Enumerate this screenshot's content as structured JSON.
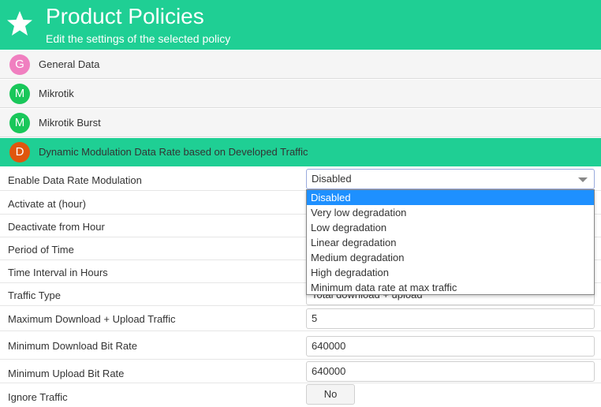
{
  "header": {
    "title": "Product Policies",
    "subtitle": "Edit the settings of the selected policy",
    "icon": "star-icon",
    "bg_color": "#1fcf94"
  },
  "sections": [
    {
      "letter": "G",
      "label": "General Data",
      "color": "#f07fc0"
    },
    {
      "letter": "M",
      "label": "Mikrotik",
      "color": "#19c75a"
    },
    {
      "letter": "M",
      "label": "Mikrotik Burst",
      "color": "#19c75a"
    },
    {
      "letter": "D",
      "label": "Dynamic Modulation Data Rate based on Developed Traffic",
      "color": "#e0560e"
    }
  ],
  "form": {
    "enable_label": "Enable Data Rate Modulation",
    "enable_value": "Disabled",
    "activate_label": "Activate at (hour)",
    "deactivate_label": "Deactivate from Hour",
    "period_label": "Period of Time",
    "interval_label": "Time Interval in Hours",
    "traffic_type_label": "Traffic Type",
    "traffic_type_value": "Total download + upload",
    "max_traffic_label": "Maximum Download + Upload Traffic",
    "max_traffic_value": "5",
    "min_download_label": "Minimum Download Bit Rate",
    "min_download_value": "640000",
    "min_upload_label": "Minimum Upload Bit Rate",
    "min_upload_value": "640000",
    "ignore_label": "Ignore Traffic",
    "ignore_value": "No"
  },
  "dropdown": {
    "options": [
      "Disabled",
      "Very low degradation",
      "Low degradation",
      "Linear degradation",
      "Medium degradation",
      "High degradation",
      "Minimum data rate at max traffic"
    ],
    "selected": "Disabled",
    "highlight_color": "#1e90ff"
  }
}
